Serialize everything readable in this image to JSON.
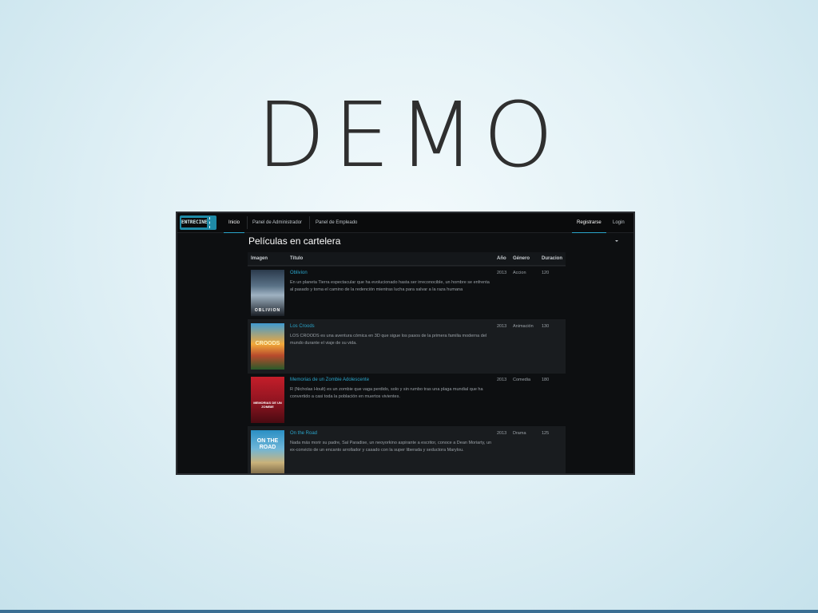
{
  "slide": {
    "title": "DEMO"
  },
  "app": {
    "logo_text": "ENTRECINE",
    "nav": {
      "items": [
        "Inicio",
        "Panel de Administrador",
        "Panel de Empleado"
      ],
      "register": "Registrarse",
      "login": "Login"
    },
    "page_title": "Películas en cartelera",
    "table": {
      "headers": [
        "Imagen",
        "Título",
        "Año",
        "Género",
        "Duracion"
      ],
      "rows": [
        {
          "poster_text": "OBLIVION",
          "title": "Oblivion",
          "description": "En un planeta Tierra espectacular que ha evolucionado hasta ser irreconocible, un hombre se enfrenta al pasado y toma el camino de la redención mientras lucha para salvar a la raza humana",
          "year": "2013",
          "genre": "Accion",
          "duration": "120"
        },
        {
          "poster_text": "CROODS",
          "title": "Los Croods",
          "description": "LOS CROODS es una aventura cómica en 3D que sigue los pasos de la primera familia moderna del mundo durante el viaje de su vida.",
          "year": "2013",
          "genre": "Animación",
          "duration": "130"
        },
        {
          "poster_text": "MEMORIAS DE UN ZOMBIE",
          "title": "Memorias de un Zombie Adolescente",
          "description": "R (Nicholas Hoult) es un zombie que vaga perdido, solo y sin rumbo tras una plaga mundial que ha convertido a casi toda la población en muertos vivientes.",
          "year": "2013",
          "genre": "Comedia",
          "duration": "180"
        },
        {
          "poster_text": "ON THE ROAD",
          "title": "On the Road",
          "description": "Nada más morir su padre, Sal Paradise, un neoyorkino aspirante a escritor, conoce a Dean Moriarty, un ex-convicto de un encanto arrollador y casado con la super liberada y seductora Marylou.",
          "year": "2013",
          "genre": "Drama",
          "duration": "125"
        }
      ]
    }
  }
}
